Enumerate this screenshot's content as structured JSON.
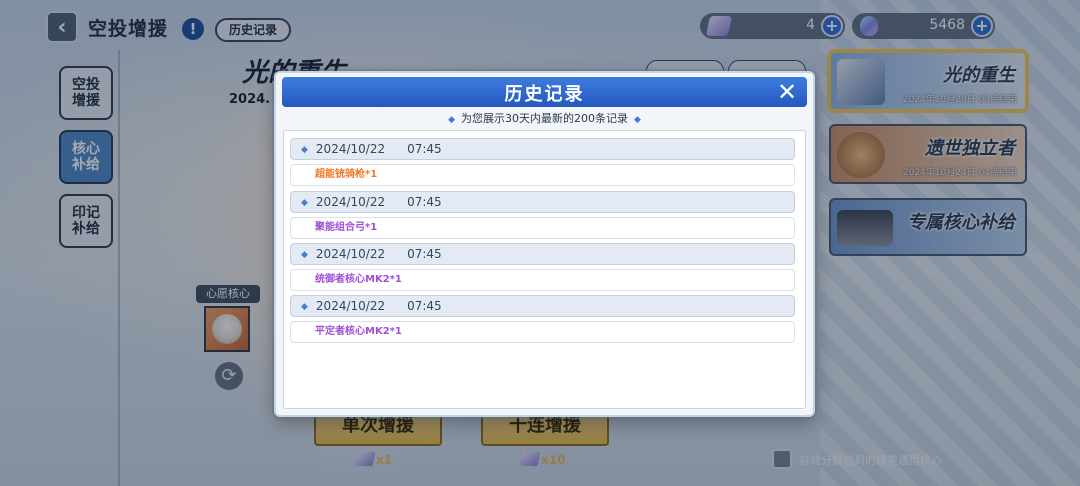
{
  "header": {
    "title": "空投增援",
    "info_icon": "!",
    "history_button": "历史记录"
  },
  "currency": [
    {
      "icon": "ticket-icon",
      "value": "4"
    },
    {
      "icon": "crystal-icon",
      "value": "5468"
    }
  ],
  "sidebar": {
    "tabs": [
      {
        "label": "空投\n增援",
        "active": false
      },
      {
        "label": "核心\n补给",
        "active": true
      },
      {
        "label": "印记\n补给",
        "active": false
      }
    ]
  },
  "wish_core": {
    "label": "心愿核心"
  },
  "banner": {
    "title": "光的重生",
    "date": "2024."
  },
  "events": [
    {
      "title": "光的重生",
      "subtitle": "2024年10月29日 03点结束"
    },
    {
      "title": "遗世独立者",
      "subtitle": "2024年10月24日 04点结束"
    },
    {
      "title": "专属核心补给",
      "subtitle": ""
    }
  ],
  "pull_buttons": [
    {
      "label": "单次增援",
      "cost": "x1"
    },
    {
      "label": "十连增援",
      "cost": "x10"
    }
  ],
  "auto_decompose": {
    "label": "自动分解抽到的精英通用核心",
    "checked": false
  },
  "modal": {
    "title": "历史记录",
    "subtitle": "为您展示30天内最新的200条记录",
    "records": [
      {
        "date": "2024/10/22",
        "time": "07:45",
        "item": "超能铳骑枪*1",
        "color": "#f07a2a"
      },
      {
        "date": "2024/10/22",
        "time": "07:45",
        "item": "聚能组合弓*1",
        "color": "#a24fd6"
      },
      {
        "date": "2024/10/22",
        "time": "07:45",
        "item": "统御者核心MK2*1",
        "color": "#a24fd6"
      },
      {
        "date": "2024/10/22",
        "time": "07:45",
        "item": "平定者核心MK2*1",
        "color": "#a24fd6"
      }
    ]
  }
}
